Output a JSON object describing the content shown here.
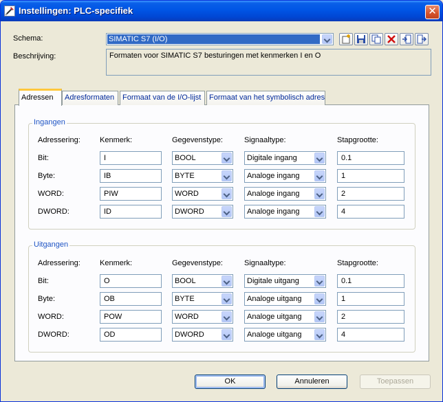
{
  "window": {
    "title": "Instellingen: PLC-specifiek",
    "close": "✕"
  },
  "schema": {
    "label": "Schema:",
    "value": "SIMATIC S7 (I/O)",
    "toolbar_icons": [
      "new-scheme-icon",
      "save-icon",
      "copy-icon",
      "delete-icon",
      "import-icon",
      "export-icon"
    ]
  },
  "description": {
    "label": "Beschrijving:",
    "value": "Formaten voor SIMATIC S7 besturingen met kenmerken I en O"
  },
  "tabs": [
    {
      "label": "Adressen",
      "active": true
    },
    {
      "label": "Adresformaten",
      "active": false
    },
    {
      "label": "Formaat van de I/O-lijst",
      "active": false
    },
    {
      "label": "Formaat van het symbolisch adres",
      "active": false
    }
  ],
  "columns": {
    "addressing": "Adressering:",
    "tag": "Kenmerk:",
    "datatype": "Gegevenstype:",
    "signaltype": "Signaaltype:",
    "stepsize": "Stapgrootte:"
  },
  "inputs": {
    "title": "Ingangen",
    "rows": [
      {
        "label": "Bit:",
        "tag": "I",
        "datatype": "BOOL",
        "signaltype": "Digitale ingang",
        "step": "0.1"
      },
      {
        "label": "Byte:",
        "tag": "IB",
        "datatype": "BYTE",
        "signaltype": "Analoge ingang",
        "step": "1"
      },
      {
        "label": "WORD:",
        "tag": "PIW",
        "datatype": "WORD",
        "signaltype": "Analoge ingang",
        "step": "2"
      },
      {
        "label": "DWORD:",
        "tag": "ID",
        "datatype": "DWORD",
        "signaltype": "Analoge ingang",
        "step": "4"
      }
    ]
  },
  "outputs": {
    "title": "Uitgangen",
    "rows": [
      {
        "label": "Bit:",
        "tag": "O",
        "datatype": "BOOL",
        "signaltype": "Digitale uitgang",
        "step": "0.1"
      },
      {
        "label": "Byte:",
        "tag": "OB",
        "datatype": "BYTE",
        "signaltype": "Analoge uitgang",
        "step": "1"
      },
      {
        "label": "WORD:",
        "tag": "POW",
        "datatype": "WORD",
        "signaltype": "Analoge uitgang",
        "step": "2"
      },
      {
        "label": "DWORD:",
        "tag": "OD",
        "datatype": "DWORD",
        "signaltype": "Analoge uitgang",
        "step": "4"
      }
    ]
  },
  "buttons": {
    "ok": "OK",
    "cancel": "Annuleren",
    "apply": "Toepassen"
  }
}
